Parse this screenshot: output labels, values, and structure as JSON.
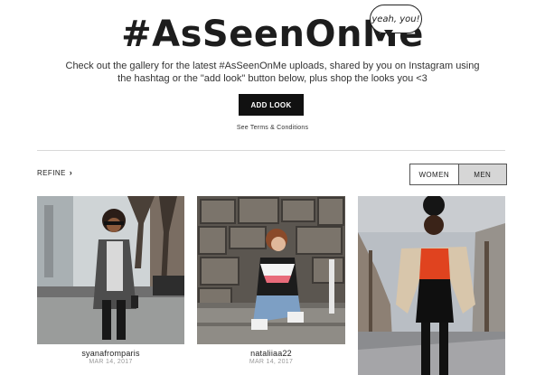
{
  "header": {
    "title": "#AsSeenOnMe",
    "bubble_text": "yeah, you!",
    "intro_text": "Check out the gallery for the latest #AsSeenOnMe uploads, shared by you on Instagram using the hashtag or the \"add look\" button below, plus shop the looks you <3",
    "add_look_label": "ADD LOOK",
    "terms_link": "See Terms & Conditions"
  },
  "filters": {
    "refine_label": "REFINE",
    "refine_icon": "chevron-right-icon",
    "gender_options": [
      "WOMEN",
      "MEN"
    ],
    "selected": "MEN"
  },
  "gallery": [
    {
      "username": "syanafromparis",
      "date": "MAR 14, 2017"
    },
    {
      "username": "nataliiaa22",
      "date": "MAR 14, 2017"
    },
    {
      "username": "",
      "date": ""
    }
  ],
  "colors": {
    "button_bg": "#111111",
    "selected_toggle_bg": "#d6d6d6",
    "divider": "#d8d8d8"
  }
}
